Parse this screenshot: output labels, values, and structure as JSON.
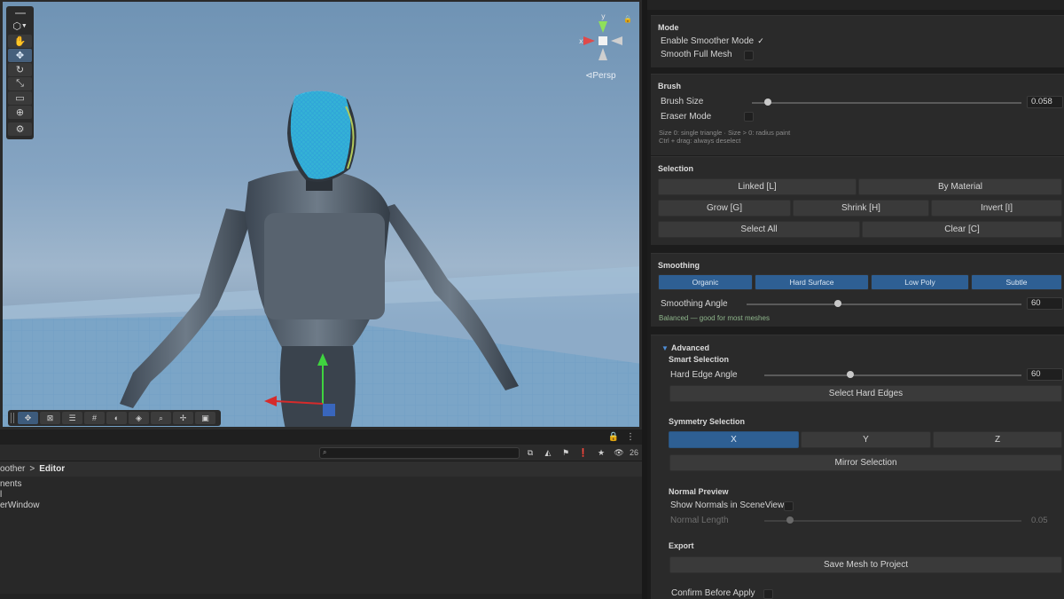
{
  "scene": {
    "projection_label": "Persp",
    "gizmo_axes": {
      "x": "x",
      "y": "y"
    },
    "tools": [
      "hand-tool",
      "move-tool",
      "rotate-tool",
      "scale-tool",
      "rect-tool",
      "transform-tool",
      "custom-tool"
    ],
    "overlay_tools": [
      "move-tool",
      "grid-tool",
      "align-tool",
      "snap-tool",
      "shading-tool",
      "mesh-tool",
      "search-tool",
      "pivot-tool",
      "camera-tool"
    ]
  },
  "project": {
    "hidden_count": "26",
    "breadcrumb": {
      "parent": "oother",
      "separator": ">",
      "current": "Editor"
    },
    "files": [
      "nents",
      "l",
      "erWindow"
    ]
  },
  "inspector": {
    "mode": {
      "title": "Mode",
      "enable_smoother_label": "Enable Smoother Mode",
      "enable_smoother_checked": "✓",
      "smooth_full_mesh_label": "Smooth Full Mesh"
    },
    "brush": {
      "title": "Brush",
      "brush_size_label": "Brush Size",
      "brush_size_value": "0.058",
      "brush_size_fraction": 0.058,
      "eraser_mode_label": "Eraser Mode",
      "help_line1": "Size 0: single triangle · Size > 0: radius paint",
      "help_line2": "Ctrl + drag: always deselect"
    },
    "selection": {
      "title": "Selection",
      "linked": "Linked [L]",
      "by_material": "By Material",
      "grow": "Grow [G]",
      "shrink": "Shrink [H]",
      "invert": "Invert [I]",
      "select_all": "Select All",
      "clear": "Clear [C]"
    },
    "smoothing": {
      "title": "Smoothing",
      "presets": [
        "Organic",
        "Hard Surface",
        "Low Poly",
        "Subtle"
      ],
      "angle_label": "Smoothing Angle",
      "angle_value": "60",
      "angle_fraction": 0.333,
      "hint": "Balanced — good for most meshes"
    },
    "advanced": {
      "title": "Advanced",
      "smart_selection_title": "Smart Selection",
      "hard_edge_label": "Hard Edge Angle",
      "hard_edge_value": "60",
      "hard_edge_fraction": 0.333,
      "select_hard_edges": "Select Hard Edges",
      "symmetry_title": "Symmetry Selection",
      "symmetry_axes": [
        "X",
        "Y",
        "Z"
      ],
      "symmetry_active": "X",
      "mirror_selection": "Mirror Selection",
      "normal_preview_title": "Normal Preview",
      "show_normals_label": "Show Normals in SceneView",
      "normal_length_label": "Normal Length",
      "normal_length_value": "0.05",
      "normal_length_fraction": 0.1,
      "export_title": "Export",
      "save_mesh": "Save Mesh to Project",
      "confirm_label": "Confirm Before Apply"
    }
  },
  "colors": {
    "accent_blue": "#2e5f93",
    "selection_cyan": "#35c8f0",
    "panel_bg": "#2a2a2a",
    "hint_green": "#8eb58b"
  }
}
